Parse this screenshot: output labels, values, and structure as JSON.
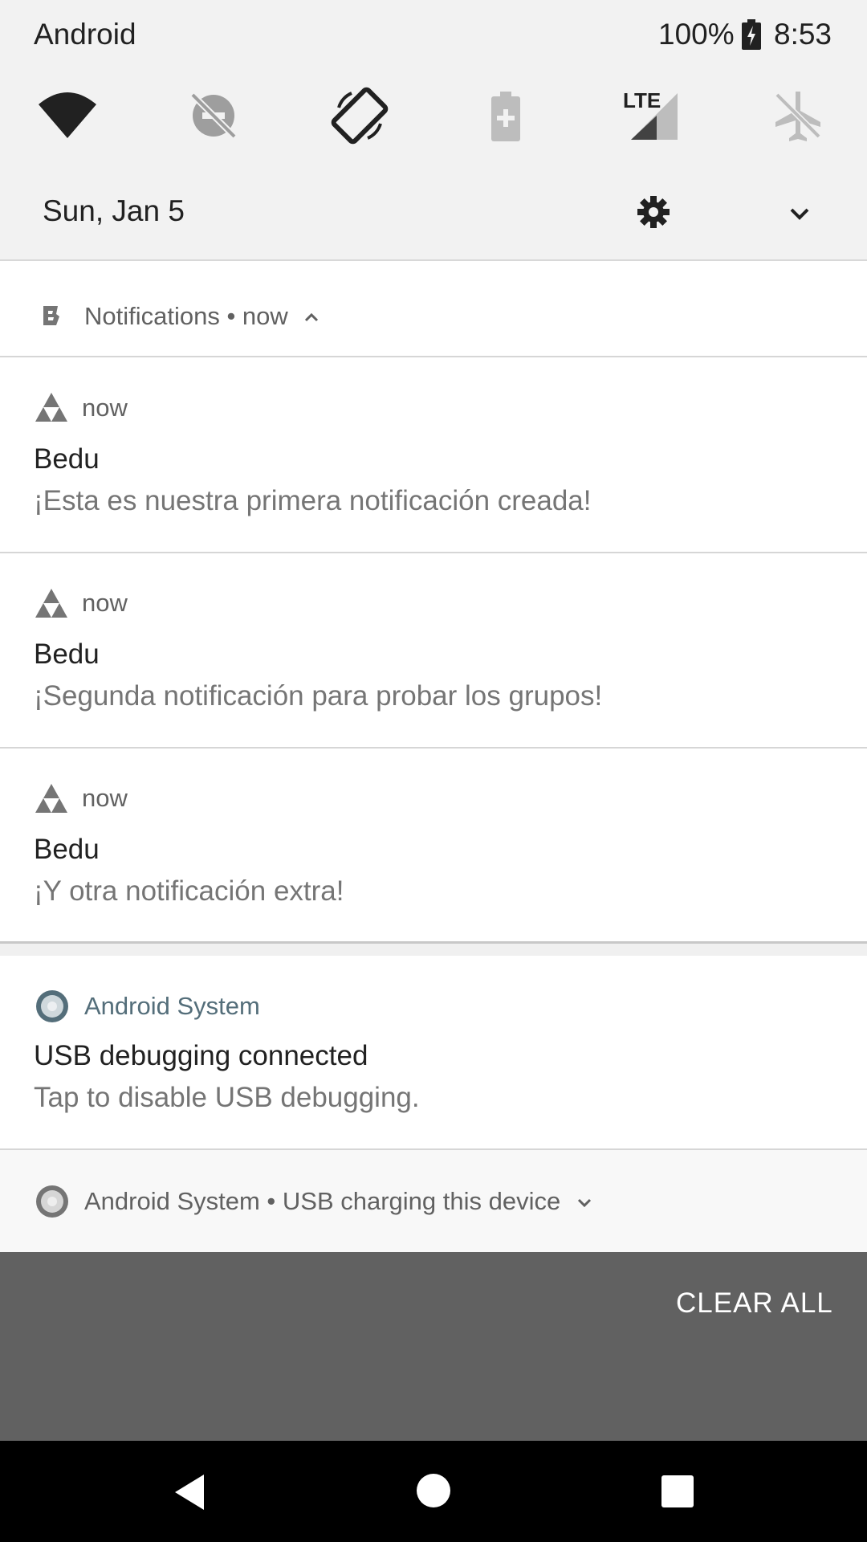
{
  "status_bar": {
    "carrier": "Android",
    "battery_percent": "100%",
    "time": "8:53"
  },
  "quick_settings": {
    "tiles": [
      "wifi-icon",
      "do-not-disturb-off-icon",
      "auto-rotate-icon",
      "battery-saver-icon",
      "lte-signal-icon",
      "airplane-mode-icon"
    ],
    "date": "Sun, Jan 5"
  },
  "notification_group": {
    "header": "Notifications • now",
    "notifications": [
      {
        "time": "now",
        "title": "Bedu",
        "text": "¡Esta es nuestra primera notificación creada!"
      },
      {
        "time": "now",
        "title": "Bedu",
        "text": "¡Segunda notificación para probar los grupos!"
      },
      {
        "time": "now",
        "title": "Bedu",
        "text": "¡Y otra notificación extra!"
      }
    ]
  },
  "system_notification": {
    "app_name": "Android System",
    "title": "USB debugging connected",
    "text": "Tap to disable USB debugging."
  },
  "usb_notification": {
    "text": "Android System • USB charging this device"
  },
  "actions": {
    "clear_all": "CLEAR ALL"
  },
  "colors": {
    "panel_bg": "#f2f2f2",
    "shade_bg": "#616161",
    "accent_app_name": "#546e7a",
    "nav_bar": "#000000"
  }
}
